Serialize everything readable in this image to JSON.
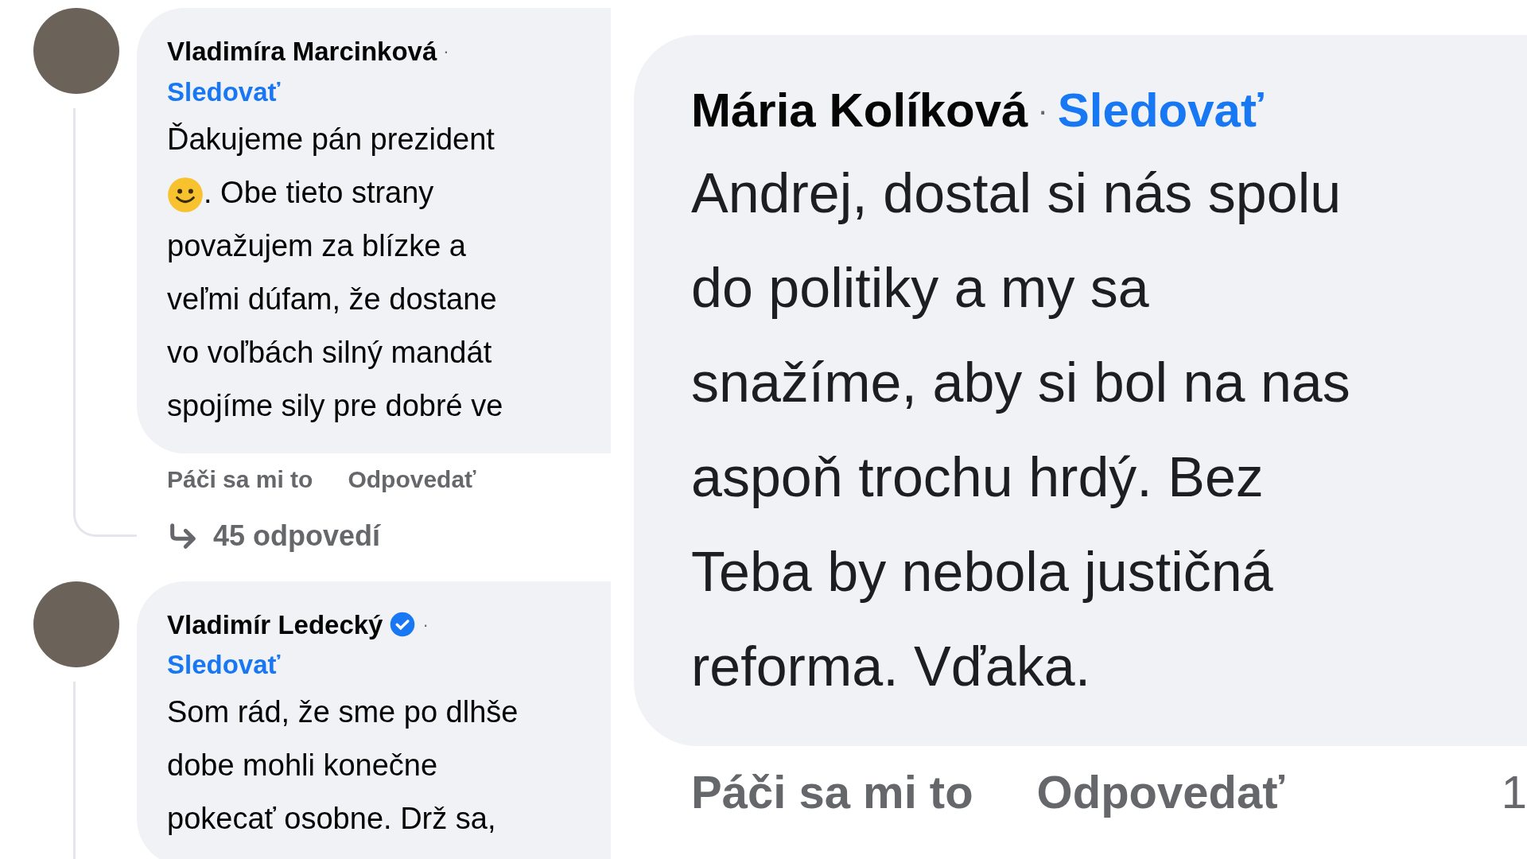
{
  "panels": [
    {
      "kind": "thread",
      "comments": [
        {
          "author": "Vladimíra Marcinková",
          "verified": false,
          "separator": "·",
          "follow": "Sledovať",
          "lines": [
            {
              "emoji": false,
              "text": "Ďakujeme pán prezident"
            },
            {
              "emoji": true,
              "text": ". Obe tieto strany"
            },
            {
              "emoji": false,
              "text": "považujem za blízke a"
            },
            {
              "emoji": false,
              "text": "veľmi dúfam, že dostane"
            },
            {
              "emoji": false,
              "text": "vo voľbách silný mandát"
            },
            {
              "emoji": false,
              "text": "spojíme sily pre dobré ve"
            }
          ],
          "actions": [
            "Páči sa mi to",
            "Odpovedať"
          ],
          "replies": "45 odpovedí"
        },
        {
          "author": "Vladimír Ledecký",
          "verified": true,
          "separator": "·",
          "follow": "Sledovať",
          "lines": [
            {
              "emoji": false,
              "text": "Som rád, že sme po dlhše"
            },
            {
              "emoji": false,
              "text": "dobe mohli konečne"
            },
            {
              "emoji": false,
              "text": "pokecať osobne. Drž sa,"
            }
          ]
        }
      ]
    },
    {
      "kind": "zoomed",
      "comments": [
        {
          "author": "Mária Kolíková",
          "verified": false,
          "separator": "·",
          "follow": "Sledovať",
          "lines": [
            {
              "emoji": false,
              "text": "Andrej, dostal si nás spolu"
            },
            {
              "emoji": false,
              "text": "do politiky a my sa"
            },
            {
              "emoji": false,
              "text": "snažíme, aby si bol na nas"
            },
            {
              "emoji": false,
              "text": "aspoň trochu hrdý. Bez"
            },
            {
              "emoji": false,
              "text": "Teba by nebola justičná"
            },
            {
              "emoji": false,
              "text": "reforma. Vďaka."
            }
          ],
          "actions": [
            "Páči sa mi to",
            "Odpovedať"
          ],
          "count": "1"
        }
      ]
    }
  ]
}
